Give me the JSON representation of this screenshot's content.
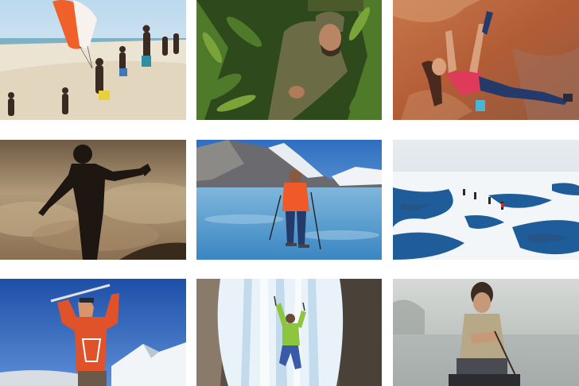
{
  "gallery": {
    "tiles": [
      {
        "icon": "beach-paraglider-kids-photo"
      },
      {
        "icon": "jungle-explorer-photo"
      },
      {
        "icon": "rock-climber-photo"
      },
      {
        "icon": "silhouette-dancer-photo"
      },
      {
        "icon": "fjord-ice-skier-photo"
      },
      {
        "icon": "frozen-lake-walkers-photo"
      },
      {
        "icon": "mountaineer-summit-photo"
      },
      {
        "icon": "ice-climber-waterfall-photo"
      },
      {
        "icon": "river-rafter-fog-photo"
      }
    ]
  }
}
